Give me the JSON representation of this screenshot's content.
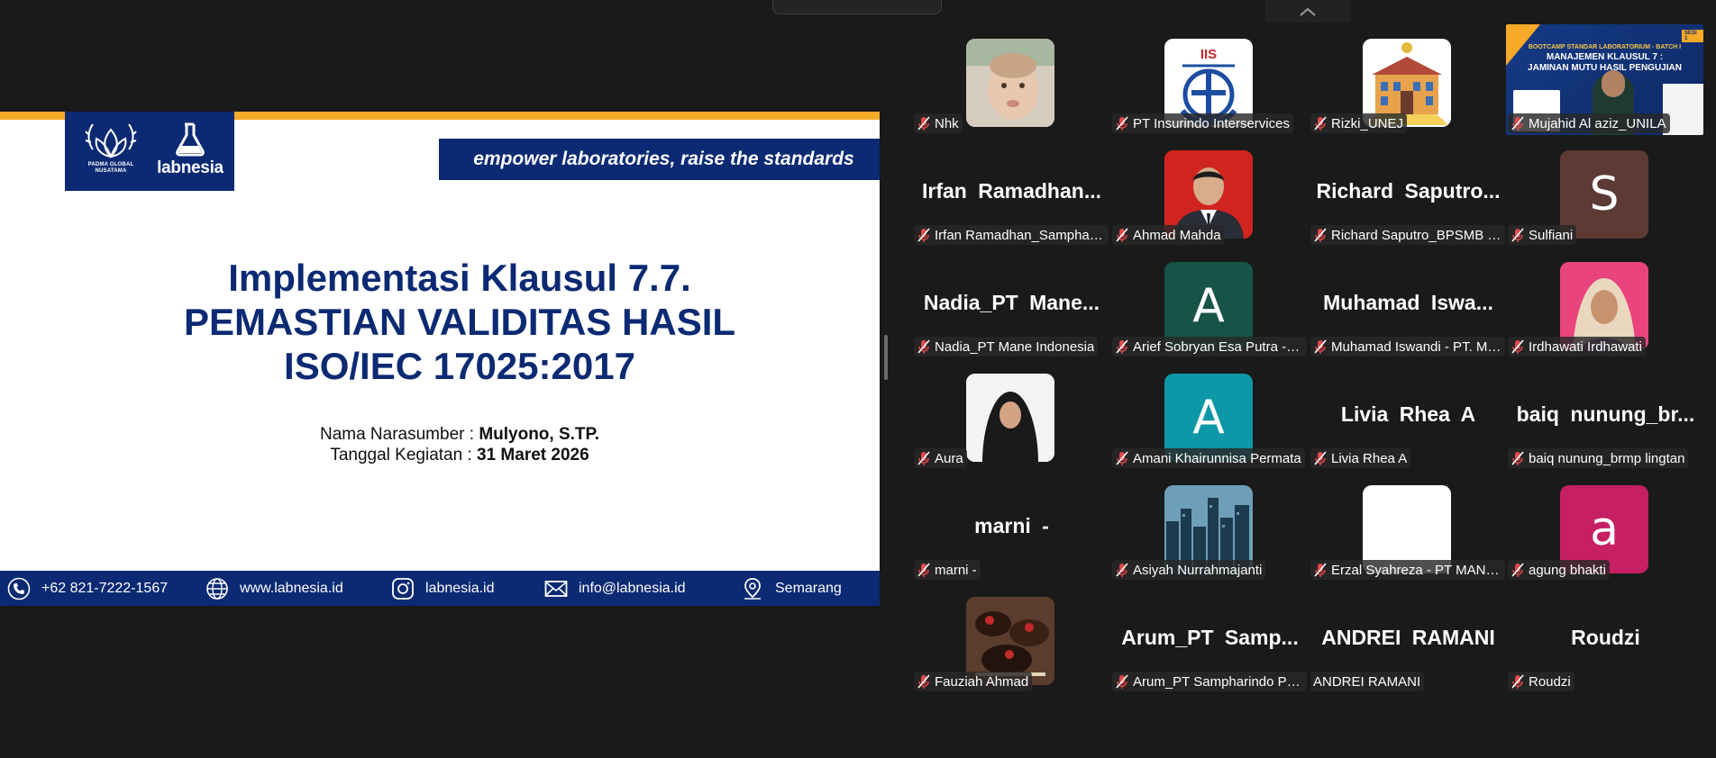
{
  "slide": {
    "tagline": "empower laboratories, raise the standards",
    "logo_left": [
      "PADMA GLOBAL",
      "NUSATAMA"
    ],
    "logo_right": "labnesia",
    "title_lines": [
      "Implementasi Klausul 7.7.",
      "PEMASTIAN VALIDITAS HASIL",
      "ISO/IEC 17025:2017"
    ],
    "speaker_label": "Nama Narasumber : ",
    "speaker_value": "Mulyono, S.TP.",
    "date_label": "Tanggal Kegiatan : ",
    "date_value": "31 Maret 2026",
    "footer": {
      "phone": "+62 821-7222-1567",
      "web": "www.labnesia.id",
      "instagram": "labnesia.id",
      "email": "info@labnesia.id",
      "location": "Semarang"
    }
  },
  "mini_slide": {
    "line1": "BOOTCAMP STANDAR LABORATORIUM - BATCH I",
    "line2": "MANAJEMEN KLAUSUL 7 :",
    "line3": "JAMINAN MUTU HASIL PENGUJIAN",
    "badge": "SESI 1"
  },
  "participants": [
    {
      "name": "Nhk",
      "muted": true,
      "tile": "photo",
      "color": "#c9b9a9"
    },
    {
      "name": "PT Insurindo Interservices",
      "muted": true,
      "tile": "logo",
      "color": "#ffffff"
    },
    {
      "name": "Rizki_UNEJ",
      "muted": true,
      "tile": "building",
      "color": "#ffffff"
    },
    {
      "name": "Mujahid Al aziz_UNILA",
      "muted": true,
      "tile": "video",
      "color": "#12387e"
    },
    {
      "name": "Irfan Ramadhan_Sampharindo",
      "display": "Irfan  Ramadhan...",
      "muted": true,
      "tile": "text"
    },
    {
      "name": "Ahmad Mahda",
      "muted": true,
      "tile": "portrait",
      "color": "#c81e1e"
    },
    {
      "name": "Richard Saputro_BPSMB Lampung",
      "display": "Richard  Saputro...",
      "muted": true,
      "tile": "text"
    },
    {
      "name": "Sulfiani",
      "muted": true,
      "tile": "letter",
      "letter": "S",
      "color": "#5d3a34"
    },
    {
      "name": "Nadia_PT Mane Indonesia",
      "display": "Nadia_PT  Mane...",
      "muted": true,
      "tile": "text"
    },
    {
      "name": "Arief Sobryan Esa Putra - PT Mane",
      "muted": true,
      "tile": "letter",
      "letter": "A",
      "color": "#155447"
    },
    {
      "name": "Muhamad Iswandi - PT. Mane",
      "display": "Muhamad  Iswa...",
      "muted": true,
      "tile": "text"
    },
    {
      "name": "Irdhawati Irdhawati",
      "muted": true,
      "tile": "hijab",
      "color": "#e9447e"
    },
    {
      "name": "Aura",
      "muted": true,
      "tile": "hijab-white",
      "color": "#eeeeee"
    },
    {
      "name": "Amani Khairunnisa Permata",
      "muted": true,
      "tile": "letter",
      "letter": "A",
      "color": "#0d97a7"
    },
    {
      "name": "Livia Rhea A",
      "display": "Livia Rhea A",
      "muted": true,
      "tile": "text"
    },
    {
      "name": "baiq nunung_brmp lingtan",
      "display": "baiq nunung_br...",
      "muted": true,
      "tile": "text"
    },
    {
      "name": "marni -",
      "display": "marni -",
      "muted": true,
      "tile": "text"
    },
    {
      "name": "Asiyah Nurrahmajanti",
      "muted": true,
      "tile": "city",
      "color": "#2a5c78"
    },
    {
      "name": "Erzal Syahreza - PT MANE Indonesia",
      "muted": true,
      "tile": "blank",
      "color": "#ffffff"
    },
    {
      "name": "agung bhakti",
      "muted": true,
      "tile": "letter",
      "letter": "a",
      "color": "#c71f63"
    },
    {
      "name": "Fauziah Ahmad",
      "muted": true,
      "tile": "food",
      "color": "#6b4a3a"
    },
    {
      "name": "Arum_PT Sampharindo Perdana",
      "display": "Arum_PT  Samp...",
      "muted": true,
      "tile": "text"
    },
    {
      "name": "ANDREI RAMANI",
      "display": "ANDREI RAMANI",
      "muted": false,
      "tile": "text"
    },
    {
      "name": "Roudzi",
      "display": "Roudzi",
      "muted": true,
      "tile": "text"
    }
  ]
}
